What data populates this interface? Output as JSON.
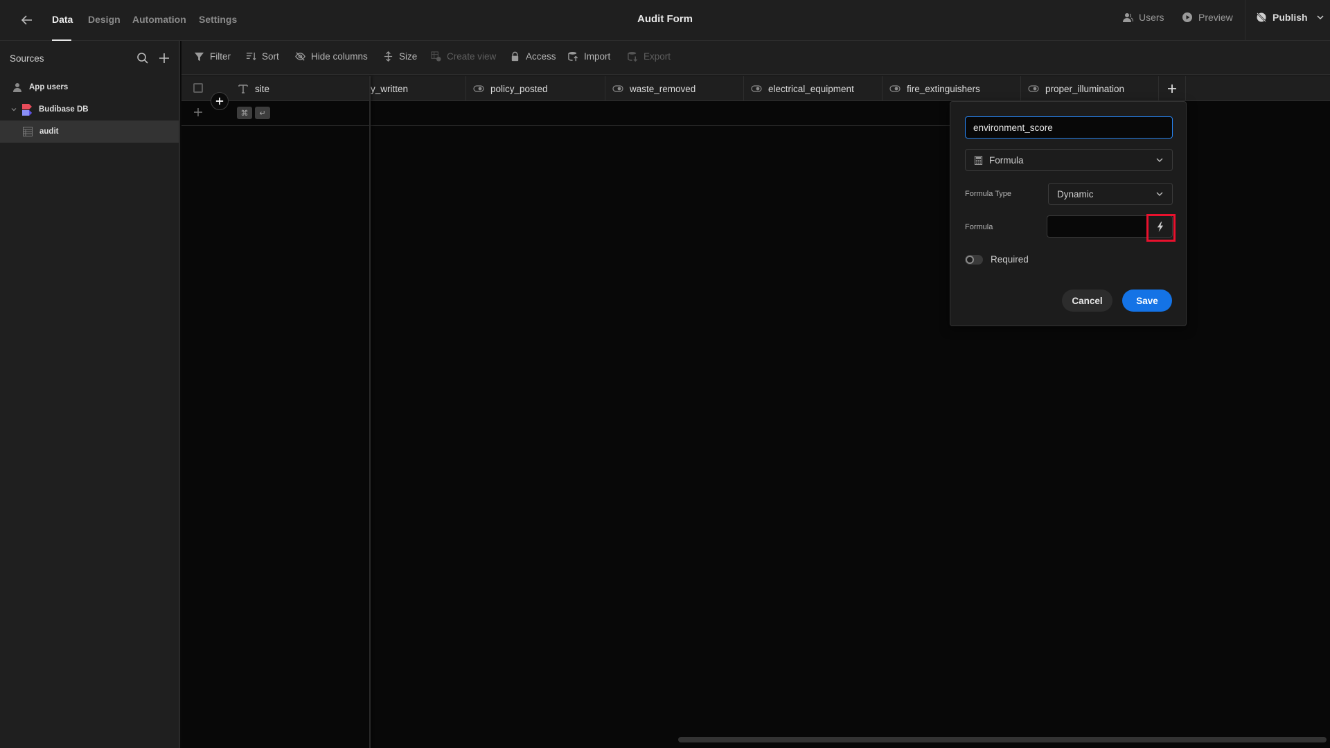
{
  "header": {
    "title": "Audit Form",
    "tabs": [
      {
        "label": "Data",
        "active": true
      },
      {
        "label": "Design",
        "active": false
      },
      {
        "label": "Automation",
        "active": false
      },
      {
        "label": "Settings",
        "active": false
      }
    ],
    "actions": {
      "users": "Users",
      "preview": "Preview",
      "publish": "Publish"
    }
  },
  "sidebar": {
    "title": "Sources",
    "items": [
      {
        "label": "App users",
        "icon": "users-icon"
      },
      {
        "label": "Budibase DB",
        "icon": "budibase-db-icon",
        "expanded": true
      },
      {
        "label": "audit",
        "icon": "table-icon",
        "selected": true
      }
    ]
  },
  "toolbar": {
    "filter": "Filter",
    "sort": "Sort",
    "hide_columns": "Hide columns",
    "size": "Size",
    "create_view": "Create view",
    "access": "Access",
    "import": "Import",
    "export": "Export"
  },
  "grid": {
    "columns": [
      {
        "name": "site",
        "type": "text"
      },
      {
        "name": "y_written",
        "type": "boolean"
      },
      {
        "name": "policy_posted",
        "type": "boolean"
      },
      {
        "name": "waste_removed",
        "type": "boolean"
      },
      {
        "name": "electrical_equipment",
        "type": "boolean"
      },
      {
        "name": "fire_extinguishers",
        "type": "boolean"
      },
      {
        "name": "proper_illumination",
        "type": "boolean"
      }
    ],
    "shortcut_keys": [
      "⌘",
      "↵"
    ]
  },
  "column_editor": {
    "name_value": "environment_score",
    "type_value": "Formula",
    "formula_type_label": "Formula Type",
    "formula_type_value": "Dynamic",
    "formula_label": "Formula",
    "formula_value": "",
    "required_label": "Required",
    "required": false,
    "cancel_label": "Cancel",
    "save_label": "Save"
  },
  "colors": {
    "accent": "#1473e6",
    "focus_border": "#2680eb",
    "highlight": "#e8112d"
  }
}
